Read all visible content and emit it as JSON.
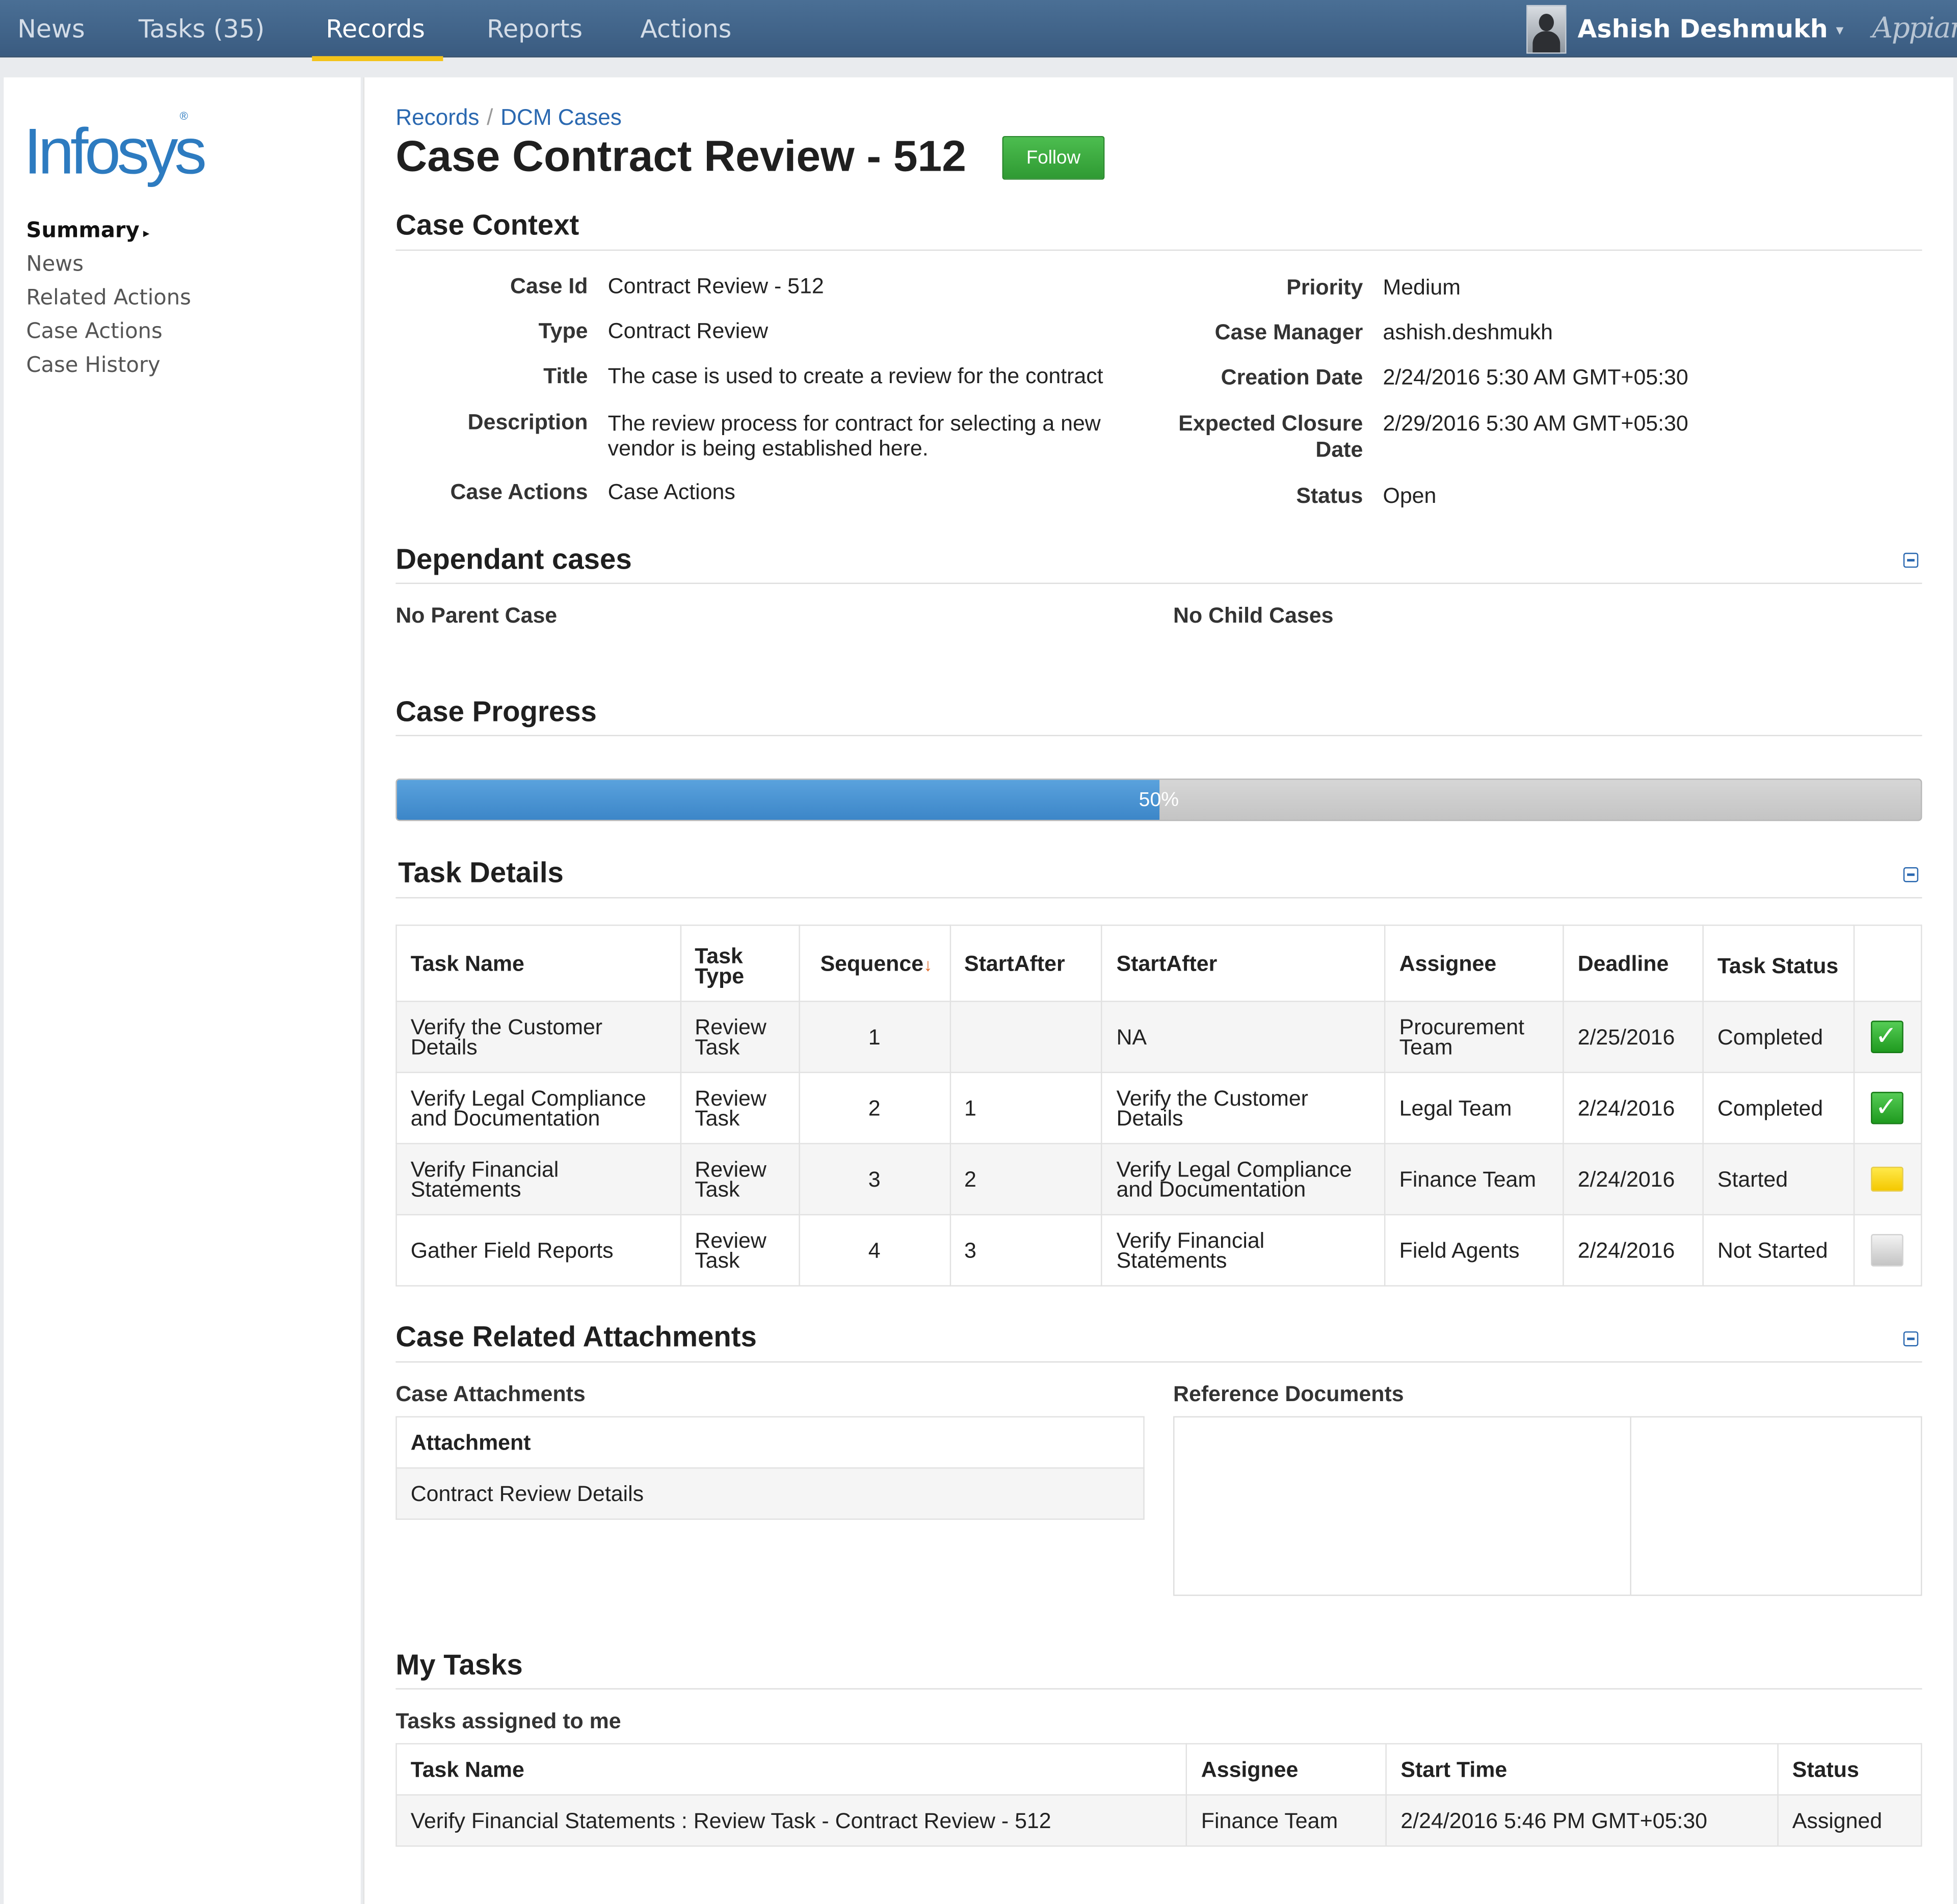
{
  "nav": {
    "items": [
      {
        "label": "News"
      },
      {
        "label": "Tasks (35)"
      },
      {
        "label": "Records"
      },
      {
        "label": "Reports"
      },
      {
        "label": "Actions"
      }
    ],
    "active": "Records",
    "user_name": "Ashish Deshmukh",
    "user_caret": "▾",
    "brand": "Appian"
  },
  "sidebar": {
    "logo": "Infosys",
    "logo_mark": "®",
    "items": [
      {
        "label": "Summary"
      },
      {
        "label": "News"
      },
      {
        "label": "Related Actions"
      },
      {
        "label": "Case Actions"
      },
      {
        "label": "Case History"
      }
    ],
    "active_arrow": "▸"
  },
  "breadcrumb": {
    "root": "Records",
    "separator": "/",
    "current": "DCM Cases"
  },
  "page": {
    "title": "Case Contract Review - 512",
    "follow_label": "Follow"
  },
  "case_context": {
    "heading": "Case Context",
    "left": [
      {
        "label": "Case Id",
        "value": "Contract Review - 512"
      },
      {
        "label": "Type",
        "value": "Contract Review"
      },
      {
        "label": "Title",
        "value": "The case is used to create a review for the contract"
      },
      {
        "label": "Description",
        "value_line1": "The review process for contract for selecting a new",
        "value_line2": "vendor is being established here."
      },
      {
        "label": "Case Actions",
        "value": "Case Actions"
      }
    ],
    "right": [
      {
        "label": "Priority",
        "value": "Medium"
      },
      {
        "label": "Case Manager",
        "value": "ashish.deshmukh"
      },
      {
        "label": "Creation Date",
        "value": "2/24/2016 5:30 AM GMT+05:30"
      },
      {
        "label_line1": "Expected Closure",
        "label_line2": "Date",
        "value": "2/29/2016 5:30 AM GMT+05:30"
      },
      {
        "label": "Status",
        "value": "Open"
      }
    ]
  },
  "dependant_cases": {
    "heading": "Dependant cases",
    "parent_text": "No Parent Case",
    "child_text": "No Child Cases"
  },
  "case_progress": {
    "heading": "Case Progress",
    "percent": 50,
    "label": "50%"
  },
  "task_details": {
    "heading": "Task Details",
    "columns": [
      "Task Name",
      "Task Type",
      "Sequence",
      "StartAfter",
      "StartAfter",
      "Assignee",
      "Deadline",
      "Task Status"
    ],
    "sort_indicator": "↓",
    "rows": [
      {
        "name": "Verify the Customer Details",
        "type": "Review Task",
        "sequence": "1",
        "start_after_seq": "",
        "start_after_task": "NA",
        "assignee": "Procurement Team",
        "deadline": "2/25/2016",
        "status": "Completed",
        "status_icon": "completed-check-icon"
      },
      {
        "name": "Verify Legal Compliance and Documentation",
        "type": "Review Task",
        "sequence": "2",
        "start_after_seq": "1",
        "start_after_task": "Verify the Customer Details",
        "assignee": "Legal Team",
        "deadline": "2/24/2016",
        "status": "Completed",
        "status_icon": "completed-check-icon"
      },
      {
        "name": "Verify Financial Statements",
        "type": "Review Task",
        "sequence": "3",
        "start_after_seq": "2",
        "start_after_task": "Verify Legal Compliance and Documentation",
        "assignee": "Finance Team",
        "deadline": "2/24/2016",
        "status": "Started",
        "status_icon": "started-yellow-icon"
      },
      {
        "name": "Gather Field Reports",
        "type": "Review Task",
        "sequence": "4",
        "start_after_seq": "3",
        "start_after_task": "Verify Financial Statements",
        "assignee": "Field Agents",
        "deadline": "2/24/2016",
        "status": "Not Started",
        "status_icon": "not-started-gray-icon"
      }
    ]
  },
  "attachments": {
    "heading": "Case Related Attachments",
    "case_attachments_label": "Case Attachments",
    "column": "Attachment",
    "items": [
      "Contract Review Details"
    ],
    "reference_label": "Reference Documents"
  },
  "my_tasks": {
    "heading": "My Tasks",
    "subheading": "Tasks assigned to me",
    "columns": [
      "Task Name",
      "Assignee",
      "Start Time",
      "Status"
    ],
    "rows": [
      {
        "name": "Verify Financial Statements : Review Task - Contract Review - 512",
        "assignee": "Finance Team",
        "start_time": "2/24/2016 5:46 PM GMT+05:30",
        "status": "Assigned"
      }
    ]
  },
  "colors": {
    "nav_bg": "#3f6289",
    "accent_underline": "#f3c31a",
    "link": "#2a68b0",
    "follow_green": "#3aa53d",
    "progress_blue": "#4a95d5"
  }
}
